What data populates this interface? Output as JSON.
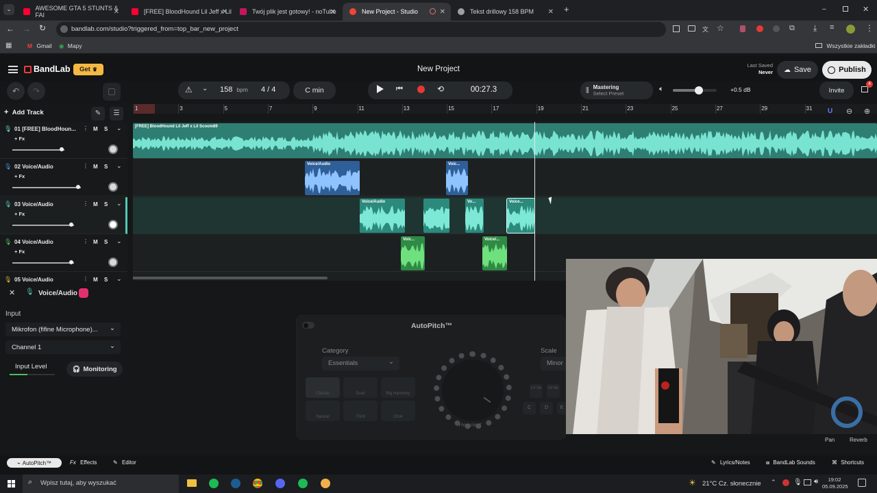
{
  "browser": {
    "tabs": [
      {
        "title": "AWESOME GTA 5 STUNTS & FAI",
        "favicon_color": "#ff0033"
      },
      {
        "title": "[FREE] BloodHound Lil Jeff x Lil",
        "favicon_color": "#ff0033"
      },
      {
        "title": "Twój plik jest gotowy! - noTube",
        "favicon_color": "#c2185b"
      },
      {
        "title": "New Project - Studio",
        "favicon_color": "#f44336"
      },
      {
        "title": "Tekst drillowy 158 BPM",
        "favicon_color": "#9aa0a6"
      }
    ],
    "active_tab": 3,
    "url": "bandlab.com/studio?triggered_from=top_bar_new_project",
    "bookmarks": [
      "Gmail",
      "Mapy"
    ],
    "all_bookmarks": "Wszystkie zakładki"
  },
  "app": {
    "brand": "BandLab",
    "get_label": "Get",
    "project_title": "New Project",
    "last_saved_label": "Last Saved",
    "last_saved_value": "Never",
    "save_label": "Save",
    "publish_label": "Publish",
    "invite_label": "Invite",
    "notif_count": "4"
  },
  "transport": {
    "bpm": "158",
    "bpm_unit": "bpm",
    "time_sig": "4 / 4",
    "key": "C min",
    "time": "00:27.3",
    "mastering_label": "Mastering",
    "mastering_preset": "Select Preset",
    "volume_db": "+0.5 dB",
    "volume_level": 0.6
  },
  "timeline": {
    "add_track": "Add Track",
    "bars": [
      "1",
      "3",
      "5",
      "7",
      "9",
      "11",
      "13",
      "15",
      "17",
      "19",
      "21",
      "23",
      "25",
      "27",
      "29",
      "31"
    ]
  },
  "tracks": [
    {
      "num": "01",
      "name": "[FREE] BloodHoun...",
      "fx": "+ Fx",
      "m": "M",
      "s": "S",
      "vol": 0.72,
      "color": "#6fd6c4"
    },
    {
      "num": "02",
      "name": "Voice/Audio",
      "fx": "+ Fx",
      "m": "M",
      "s": "S",
      "vol": 0.96,
      "color": "#4a8fd8"
    },
    {
      "num": "03",
      "name": "Voice/Audio",
      "fx": "+ Fx",
      "m": "M",
      "s": "S",
      "vol": 0.86,
      "color": "#56c7b4"
    },
    {
      "num": "04",
      "name": "Voice/Audio",
      "fx": "+ Fx",
      "m": "M",
      "s": "S",
      "vol": 0.86,
      "color": "#4fbf5e"
    },
    {
      "num": "05",
      "name": "Voice/Audio",
      "m": "M",
      "s": "S"
    }
  ],
  "clips": {
    "beat_title": "[FREE] BloodHound Lil Jeff x Lil Scoom89",
    "track2": [
      "Voice/Audio",
      "Voic..."
    ],
    "track3": [
      "Voice/Audio",
      "",
      "Vo...",
      "Voice..."
    ],
    "track4": [
      "Voic...",
      "Voice/..."
    ]
  },
  "inspector": {
    "track_name": "Voice/Audio",
    "input_label": "Input",
    "input_device": "Mikrofon (fifine Microphone)...",
    "channel": "Channel 1",
    "input_level_label": "Input Level",
    "monitoring_label": "Monitoring"
  },
  "autopitch": {
    "title": "AutoPitch™",
    "category_label": "Category",
    "category_value": "Essentials",
    "scale_label": "Scale",
    "scale_value": "Minor",
    "presets": [
      "Classic",
      "Duet",
      "Big Harmony",
      "Natural",
      "Third",
      "Choir"
    ],
    "knob_label": "Heaviest",
    "notes": [
      "C",
      "D",
      "E"
    ],
    "note_sharps": [
      "C#\nDb",
      "D#\nEb"
    ],
    "pan_label": "Pan",
    "reverb_label": "Reverb"
  },
  "footer": {
    "autopitch": "AutoPitch™",
    "effects": "Effects",
    "editor": "Editor",
    "lyrics": "Lyrics/Notes",
    "sounds": "BandLab Sounds",
    "shortcuts": "Shortcuts"
  },
  "taskbar": {
    "search_placeholder": "Wpisz tutaj, aby wyszukać",
    "weather": "21°C Cz. słonecznie",
    "time": "19:02",
    "date": "05.09.2025"
  }
}
